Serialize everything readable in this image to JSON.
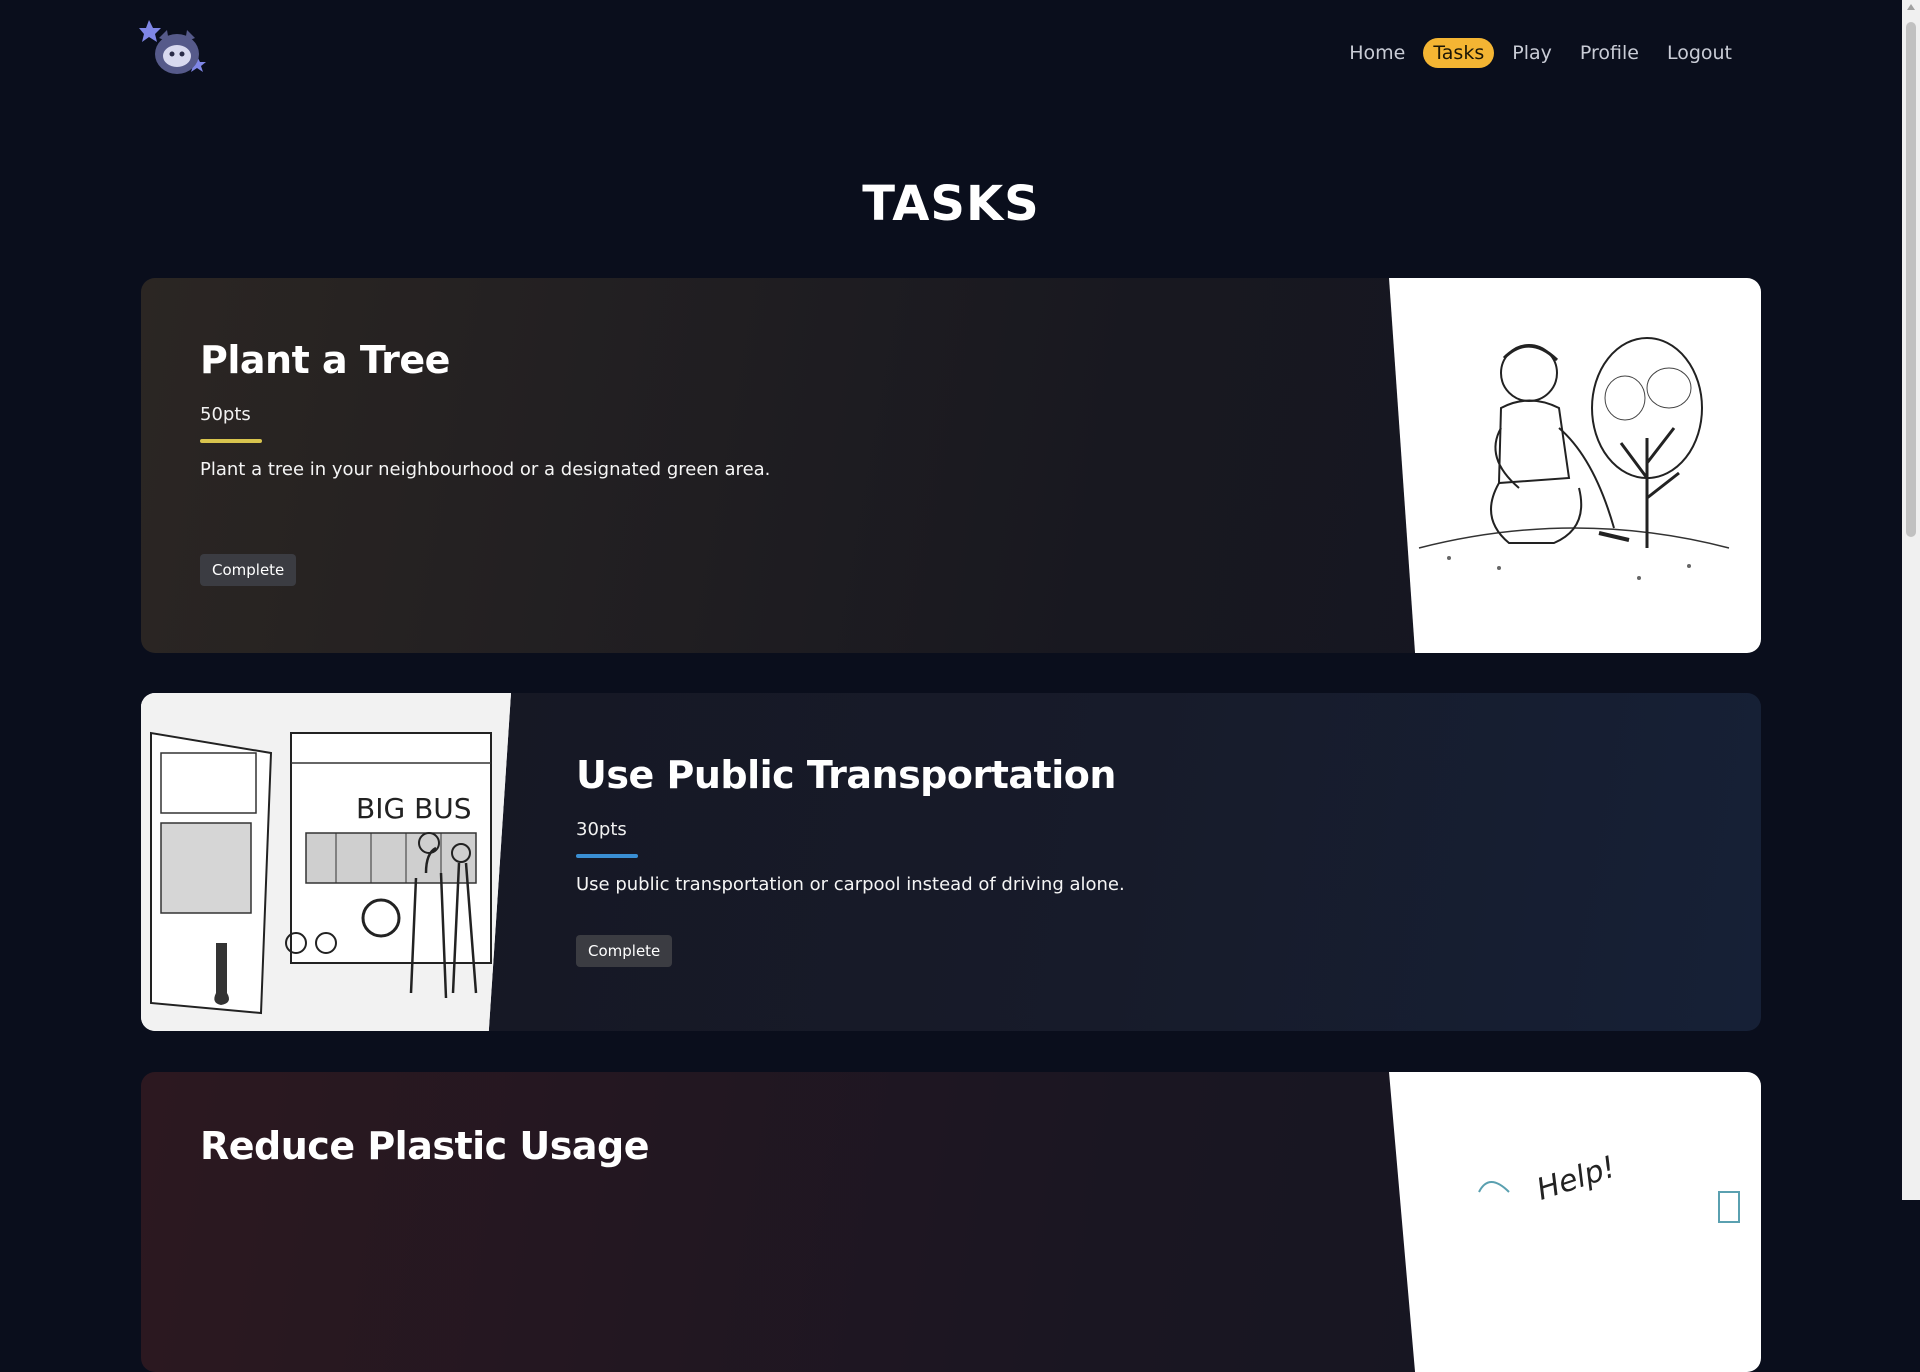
{
  "nav": {
    "links": [
      {
        "label": "Home"
      },
      {
        "label": "Tasks"
      },
      {
        "label": "Play"
      },
      {
        "label": "Profile"
      },
      {
        "label": "Logout"
      }
    ],
    "active": "Tasks"
  },
  "page": {
    "title": "TASKS"
  },
  "tasks": [
    {
      "title": "Plant a Tree",
      "points": "50pts",
      "description": "Plant a tree in your neighbourhood or a designated green area.",
      "button": "Complete",
      "image": "boy-planting-tree-sketch"
    },
    {
      "title": "Use Public Transportation",
      "points": "30pts",
      "description": "Use public transportation or carpool instead of driving alone.",
      "button": "Complete",
      "image": "big-bus-street-sketch",
      "image_text": "BIG BUS"
    },
    {
      "title": "Reduce Plastic Usage",
      "image": "plastic-help-sketch",
      "image_text": "Help!"
    }
  ],
  "colors": {
    "background": "#0a0e1c",
    "active_pill": "#f4b533",
    "underline_gold": "#d8c44e",
    "underline_blue": "#3a8fd4",
    "button": "#3b3c42"
  }
}
